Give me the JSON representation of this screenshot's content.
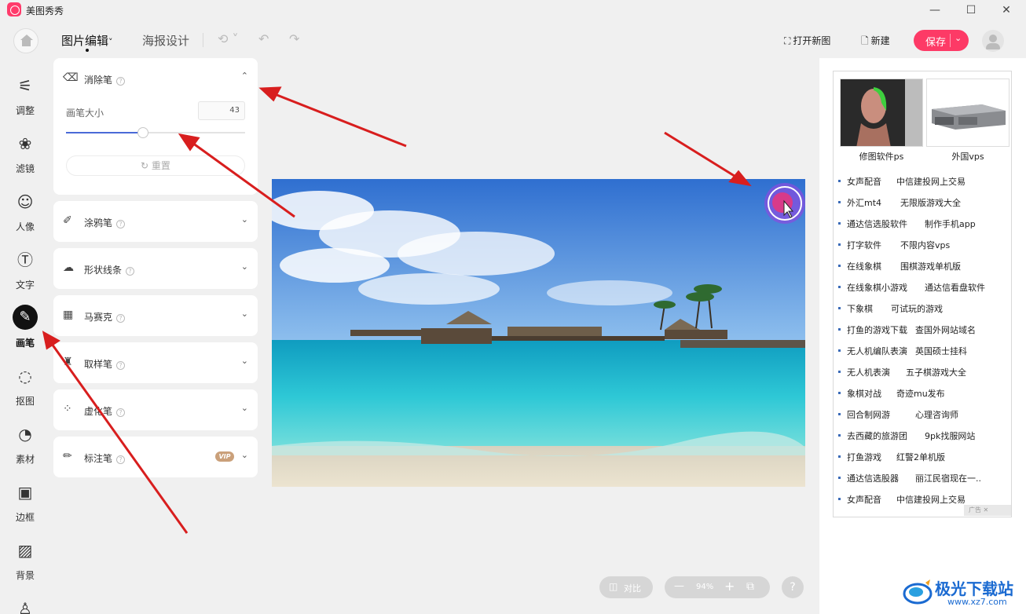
{
  "app": {
    "title": "美图秀秀"
  },
  "window": {
    "minimize": "—",
    "maximize": "☐",
    "close": "✕"
  },
  "toolbar": {
    "tab_image_edit": "图片编辑",
    "tab_image_edit_caret": "˅",
    "tab_poster": "海报设计",
    "history_icon": "⟲ ˅",
    "undo_icon": "↶",
    "redo_icon": "↷",
    "open_new": "打开新图",
    "new": "新建",
    "save": "保存",
    "save_caret": "⌄"
  },
  "sidebar": {
    "items": [
      {
        "label": "调整",
        "icon": "adjust-icon",
        "glyph": "⚟"
      },
      {
        "label": "滤镜",
        "icon": "filter-icon",
        "glyph": "❀"
      },
      {
        "label": "人像",
        "icon": "portrait-icon",
        "glyph": "☺"
      },
      {
        "label": "文字",
        "icon": "text-icon",
        "glyph": "Ⓣ"
      },
      {
        "label": "画笔",
        "icon": "brush-icon",
        "glyph": "✎"
      },
      {
        "label": "抠图",
        "icon": "cutout-icon",
        "glyph": "◌"
      },
      {
        "label": "素材",
        "icon": "sticker-icon",
        "glyph": "◔"
      },
      {
        "label": "边框",
        "icon": "frame-icon",
        "glyph": "▣"
      },
      {
        "label": "背景",
        "icon": "background-icon",
        "glyph": "▨"
      },
      {
        "label": "",
        "icon": "person-icon",
        "glyph": "♙"
      }
    ],
    "active": "画笔"
  },
  "tool_panel": {
    "eraser": {
      "label": "消除笔",
      "size_label": "画笔大小",
      "size_value": "43",
      "size_fraction": 0.43,
      "reset": "重置"
    },
    "tools": [
      {
        "label": "涂鸦笔",
        "icon": "doodle-pen-icon",
        "glyph": "✐"
      },
      {
        "label": "形状线条",
        "icon": "shape-line-icon",
        "glyph": "☁"
      },
      {
        "label": "马赛克",
        "icon": "mosaic-icon",
        "glyph": "▦"
      },
      {
        "label": "取样笔",
        "icon": "sample-pen-icon",
        "glyph": "♜"
      },
      {
        "label": "虚化笔",
        "icon": "blur-pen-icon",
        "glyph": "⁘"
      },
      {
        "label": "标注笔",
        "icon": "marker-pen-icon",
        "glyph": "✏",
        "badge": "VIP"
      }
    ]
  },
  "canvas": {
    "compare": "对比",
    "zoom": "94%",
    "zoom_out": "—",
    "zoom_in": "+",
    "fit": "⧉",
    "help": "?"
  },
  "ads": {
    "thumbs": [
      {
        "caption": "修图软件ps"
      },
      {
        "caption": "外国vps"
      }
    ],
    "rows": [
      [
        "女声配音",
        "中信建投网上交易"
      ],
      [
        "外汇mt4",
        "无限版游戏大全"
      ],
      [
        "通达信选股软件",
        "制作手机app"
      ],
      [
        "打字软件",
        "不限内容vps"
      ],
      [
        "在线象棋",
        "围棋游戏单机版"
      ],
      [
        "在线象棋小游戏",
        "通达信看盘软件"
      ],
      [
        "下象棋",
        "可试玩的游戏"
      ],
      [
        "打鱼的游戏下载",
        "查国外网站域名"
      ],
      [
        "无人机编队表演",
        "英国硕士挂科"
      ],
      [
        "无人机表演",
        "五子棋游戏大全"
      ],
      [
        "象棋对战",
        "奇迹mu发布"
      ],
      [
        "回合制网游",
        "心理咨询师"
      ],
      [
        "去西藏的旅游团",
        "9pk找服网站"
      ],
      [
        "打鱼游戏",
        "红警2单机版"
      ],
      [
        "通达信选股器",
        "丽江民宿现在一.."
      ],
      [
        "女声配音",
        "中信建投网上交易"
      ]
    ],
    "footer": "广告 ✕"
  },
  "watermark": {
    "name": "极光下载站",
    "url": "www.xz7.com"
  },
  "colors": {
    "accent": "#fd3a66",
    "slider": "#4a6ad8",
    "arrow": "#d81e1e"
  }
}
